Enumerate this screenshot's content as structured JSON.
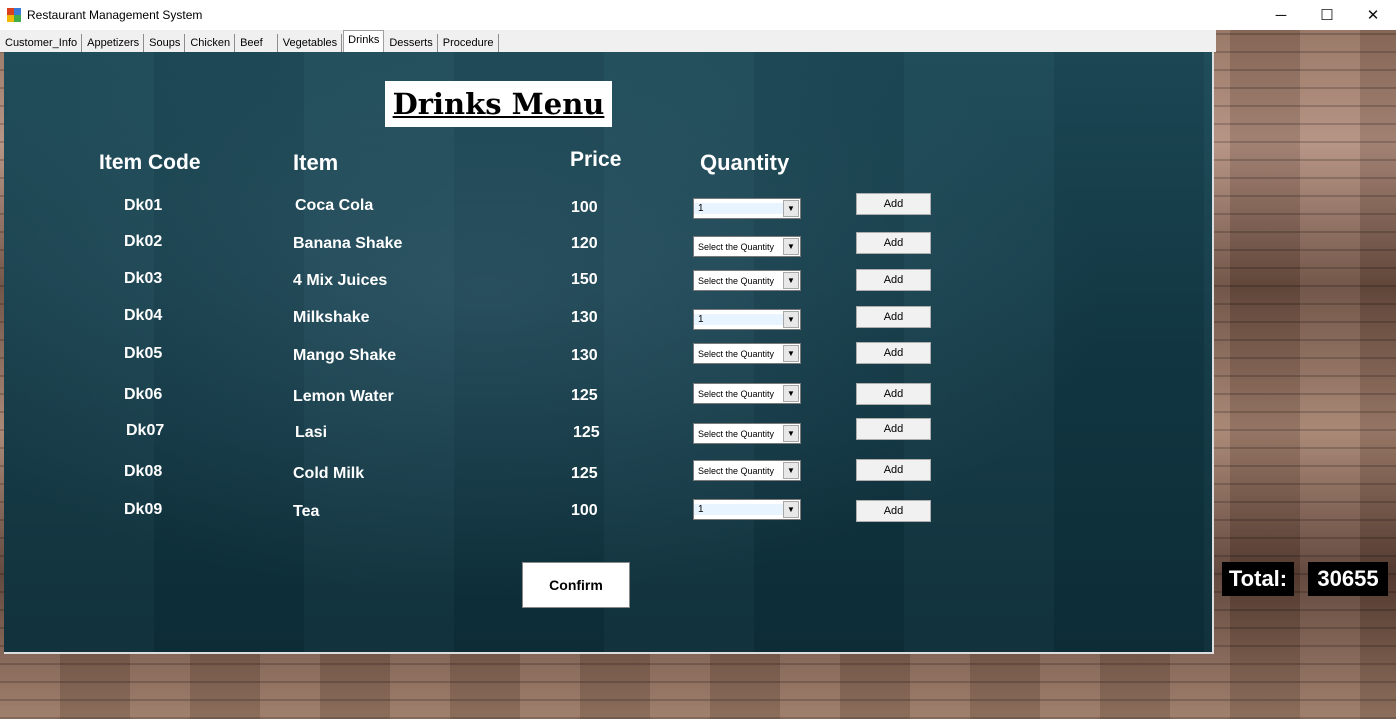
{
  "window": {
    "title": "Restaurant Management System",
    "minimize_glyph": "─",
    "maximize_glyph": "☐",
    "close_glyph": "✕"
  },
  "tabs": [
    {
      "label": "Customer_Info"
    },
    {
      "label": "Appetizers"
    },
    {
      "label": "Soups"
    },
    {
      "label": "Chicken"
    },
    {
      "label": "Beef"
    },
    {
      "label": "Vegetables"
    },
    {
      "label": "Drinks",
      "active": true
    },
    {
      "label": "Desserts"
    },
    {
      "label": "Procedure"
    }
  ],
  "menu": {
    "title": "Drinks Menu",
    "headers": {
      "code": "Item Code",
      "item": "Item",
      "price": "Price",
      "quantity": "Quantity"
    },
    "add_label": "Add",
    "arrow_glyph": "▼",
    "rows": [
      {
        "code": "Dk01",
        "item": "Coca Cola",
        "price": "100",
        "quantity": "1"
      },
      {
        "code": "Dk02",
        "item": "Banana Shake",
        "price": "120",
        "quantity": "Select the Quantity"
      },
      {
        "code": "Dk03",
        "item": "4 Mix Juices",
        "price": "150",
        "quantity": "Select the Quantity"
      },
      {
        "code": "Dk04",
        "item": "Milkshake",
        "price": "130",
        "quantity": "1"
      },
      {
        "code": "Dk05",
        "item": "Mango Shake",
        "price": "130",
        "quantity": "Select the Quantity"
      },
      {
        "code": "Dk06",
        "item": "Lemon Water",
        "price": "125",
        "quantity": "Select the Quantity"
      },
      {
        "code": "Dk07",
        "item": "Lasi",
        "price": "125",
        "quantity": "Select the Quantity"
      },
      {
        "code": "Dk08",
        "item": "Cold Milk",
        "price": "125",
        "quantity": "Select the Quantity"
      },
      {
        "code": "Dk09",
        "item": "Tea",
        "price": "100",
        "quantity": "1"
      }
    ],
    "confirm_label": "Confirm"
  },
  "total": {
    "label": "Total:",
    "value": "30655"
  }
}
